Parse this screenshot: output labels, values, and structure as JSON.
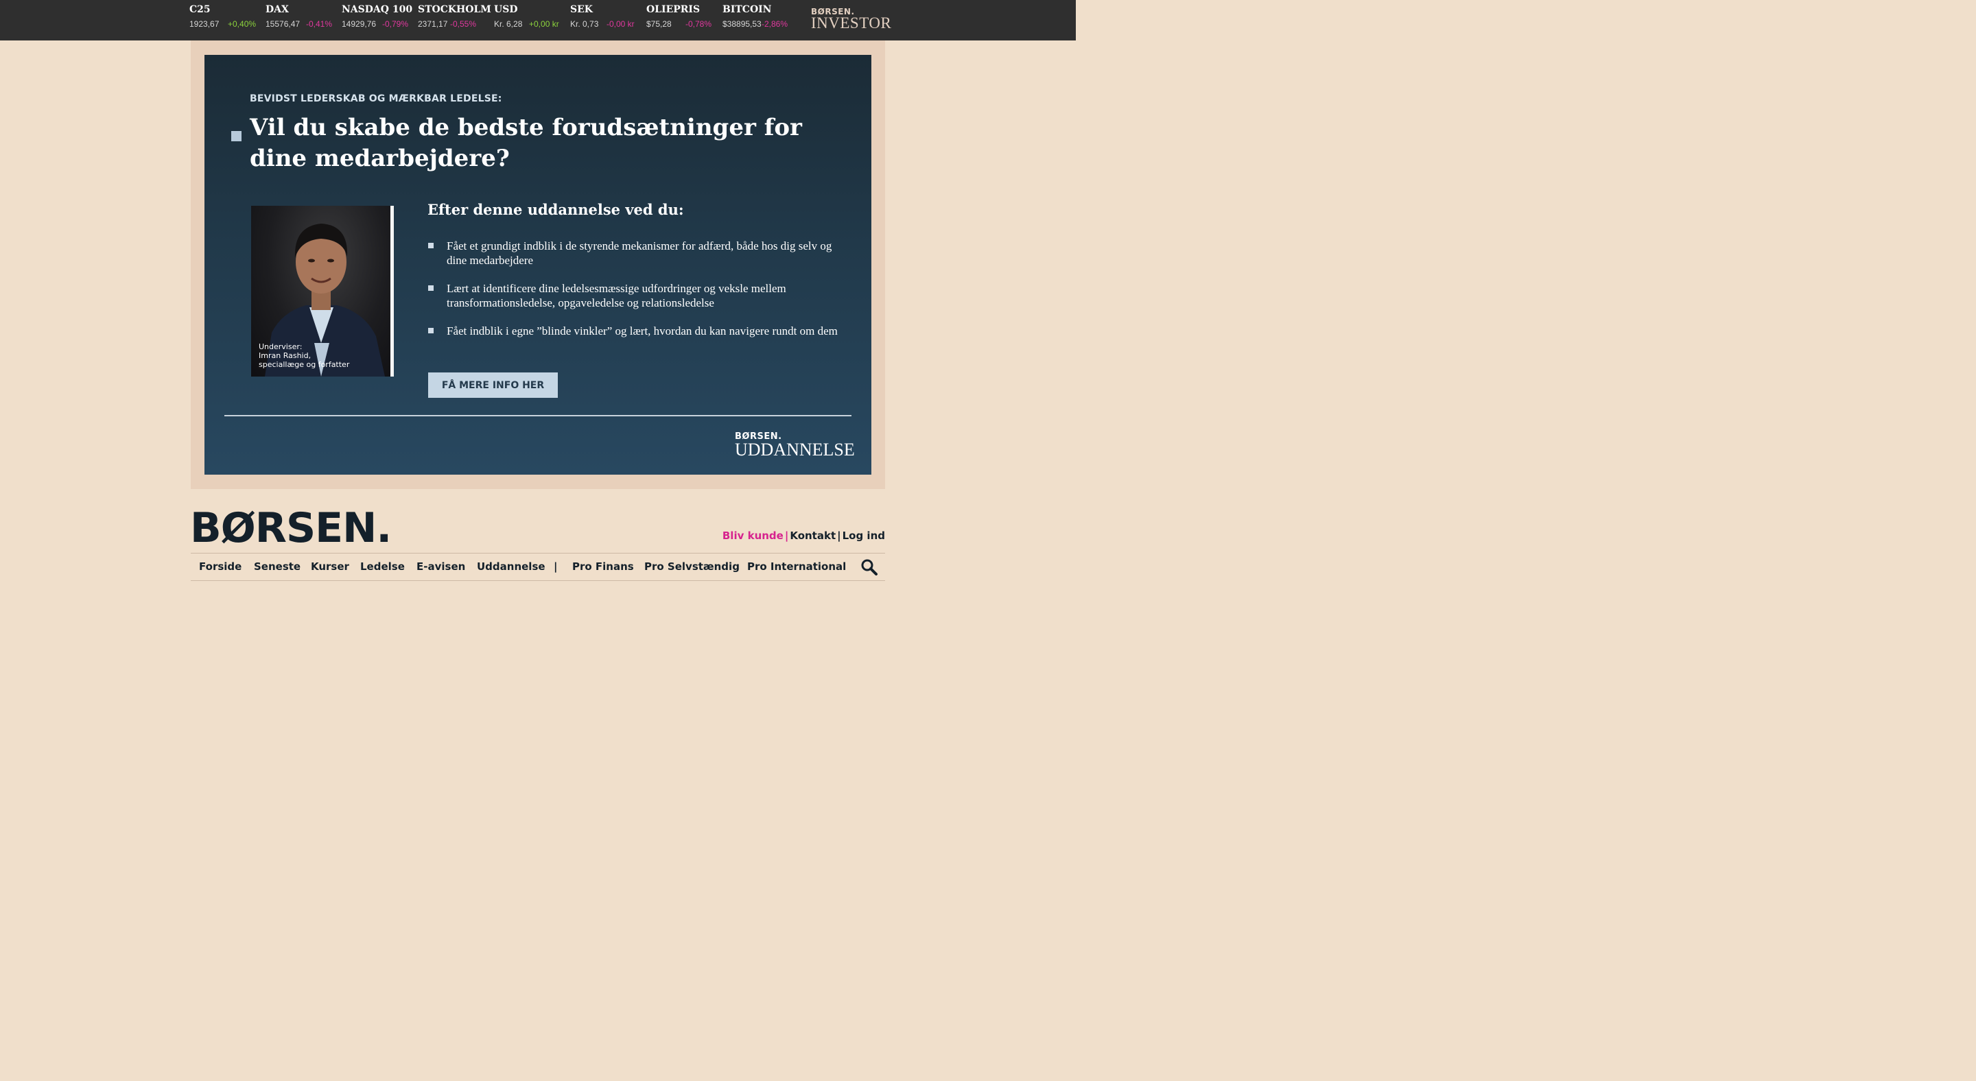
{
  "ticker": {
    "items": [
      {
        "name": "C25",
        "value": "1923,67",
        "change": "+0,40%",
        "direction": "up"
      },
      {
        "name": "DAX",
        "value": "15576,47",
        "change": "-0,41%",
        "direction": "down"
      },
      {
        "name": "NASDAQ 100",
        "value": "14929,76",
        "change": "-0,79%",
        "direction": "down"
      },
      {
        "name": "STOCKHOLM",
        "value": "2371,17",
        "change": "-0,55%",
        "direction": "down"
      },
      {
        "name": "USD",
        "value": "Kr. 6,28",
        "change": "+0,00 kr",
        "direction": "up"
      },
      {
        "name": "SEK",
        "value": "Kr. 0,73",
        "change": "-0,00 kr",
        "direction": "down"
      },
      {
        "name": "OLIEPRIS",
        "value": "$75,28",
        "change": "-0,78%",
        "direction": "down"
      },
      {
        "name": "BITCOIN",
        "value": "$38895,53",
        "change": "-2,86%",
        "direction": "down"
      }
    ],
    "colors": {
      "up": "#8cd33c",
      "down": "#e0389e"
    },
    "investor_logo_top": "BØRSEN.",
    "investor_logo_bottom": "INVESTOR"
  },
  "ad": {
    "eyebrow": "BEVIDST LEDERSKAB OG MÆRKBAR LEDELSE:",
    "headline": "Vil du skabe de bedste forudsætninger for dine medarbejdere?",
    "photo_caption": [
      "Underviser:",
      "Imran Rashid,",
      "speciallæge og forfatter"
    ],
    "subhead": "Efter denne uddannelse ved du:",
    "bullets": [
      "Fået et grundigt indblik i de styrende mekanismer for adfærd, både hos dig selv og dine medarbejdere",
      "Lært at identificere dine ledelsesmæssige udfordringer og veksle mellem transformationsledelse, opgaveledelse og relationsledelse",
      "Fået indblik i egne ”blinde vinkler” og lært, hvordan du kan navigere rundt om dem"
    ],
    "cta_label": "FÅ MERE INFO HER",
    "logo_top": "BØRSEN.",
    "logo_bottom": "UDDANNELSE"
  },
  "masthead": {
    "logo": "BØRSEN.",
    "become_customer": "Bliv kunde",
    "separator": "|",
    "contact": "Kontakt",
    "login": "Log ind"
  },
  "nav": {
    "items": [
      "Forside",
      "Seneste",
      "Kurser",
      "Ledelse",
      "E-avisen",
      "Uddannelse",
      "|",
      "Pro Finans",
      "Pro Selvstændig",
      "Pro International"
    ],
    "search_icon": "search-icon"
  }
}
